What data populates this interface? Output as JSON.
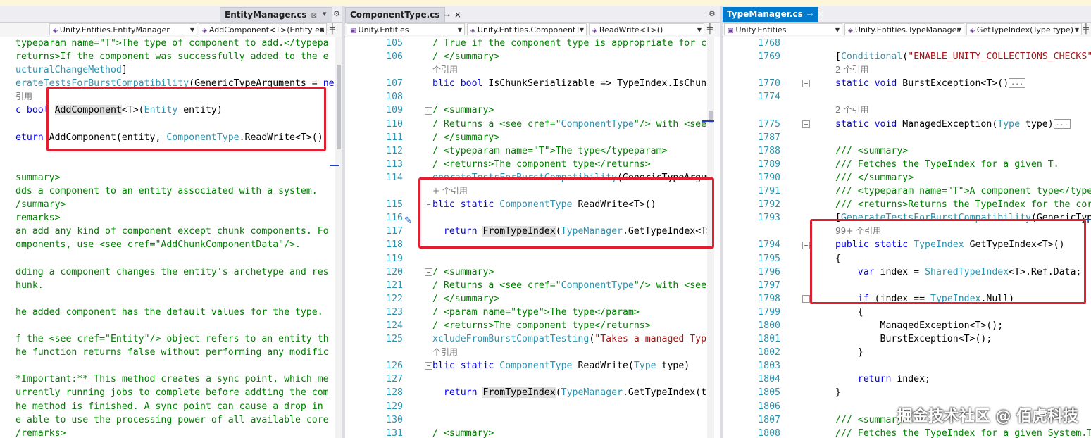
{
  "panes": [
    {
      "tab_label": "EntityManager.cs",
      "tab_pin": "⊠",
      "tab_menu": "▾",
      "tab_settings": "⚙",
      "nav": [
        "Unity.Entities.EntityManager",
        "AddComponent<T>(Entity en"
      ],
      "lines": [
        {
          "n": "",
          "segs": [
            [
              "cm",
              "typeparam name=\"T\">The type of component to add.</typepa"
            ]
          ]
        },
        {
          "n": "",
          "segs": [
            [
              "cm",
              "returns>If the component was successfully added to the e"
            ]
          ]
        },
        {
          "n": "",
          "segs": [
            [
              "ty",
              "ucturalChangeMethod"
            ],
            [
              "pl",
              "]"
            ]
          ]
        },
        {
          "n": "",
          "segs": [
            [
              "ty",
              "erateTestsForBurstCompatibility"
            ],
            [
              "pl",
              "(GenericTypeArguments = "
            ],
            [
              "kw",
              "ne"
            ]
          ]
        },
        {
          "n": "",
          "segs": [
            [
              "sm",
              "引用"
            ]
          ]
        },
        {
          "n": "",
          "segs": [
            [
              "kw",
              "c bool "
            ],
            [
              "hl",
              "AddComponent"
            ],
            [
              "pl",
              "<T>("
            ],
            [
              "ty",
              "Entity"
            ],
            [
              "pl",
              " entity)"
            ]
          ]
        },
        {
          "n": "",
          "segs": [
            [
              "pl",
              ""
            ]
          ]
        },
        {
          "n": "",
          "segs": [
            [
              "kw",
              "eturn "
            ],
            [
              "pl",
              "AddComponent(entity, "
            ],
            [
              "ty",
              "ComponentType"
            ],
            [
              "pl",
              ".ReadWrite<T>()"
            ]
          ]
        },
        {
          "n": "",
          "segs": [
            [
              "pl",
              ""
            ]
          ]
        },
        {
          "n": "",
          "segs": [
            [
              "pl",
              ""
            ]
          ]
        },
        {
          "n": "",
          "segs": [
            [
              "cm",
              "summary>"
            ]
          ]
        },
        {
          "n": "",
          "segs": [
            [
              "cm",
              "dds a component to an entity associated with a system."
            ]
          ]
        },
        {
          "n": "",
          "segs": [
            [
              "cm",
              "/summary>"
            ]
          ]
        },
        {
          "n": "",
          "segs": [
            [
              "cm",
              "remarks>"
            ]
          ]
        },
        {
          "n": "",
          "segs": [
            [
              "cm",
              "an add any kind of component except chunk components. Fo"
            ]
          ]
        },
        {
          "n": "",
          "segs": [
            [
              "cm",
              "omponents, use <see cref=\"AddChunkComponentData\"/>."
            ]
          ]
        },
        {
          "n": "",
          "segs": [
            [
              "pl",
              ""
            ]
          ]
        },
        {
          "n": "",
          "segs": [
            [
              "cm",
              "dding a component changes the entity's archetype and res"
            ]
          ]
        },
        {
          "n": "",
          "segs": [
            [
              "cm",
              "hunk."
            ]
          ]
        },
        {
          "n": "",
          "segs": [
            [
              "pl",
              ""
            ]
          ]
        },
        {
          "n": "",
          "segs": [
            [
              "cm",
              "he added component has the default values for the type."
            ]
          ]
        },
        {
          "n": "",
          "segs": [
            [
              "pl",
              ""
            ]
          ]
        },
        {
          "n": "",
          "segs": [
            [
              "cm",
              "f the <see cref=\"Entity\"/> object refers to an entity th"
            ]
          ]
        },
        {
          "n": "",
          "segs": [
            [
              "cm",
              "he function returns false without performing any modific"
            ]
          ]
        },
        {
          "n": "",
          "segs": [
            [
              "pl",
              ""
            ]
          ]
        },
        {
          "n": "",
          "segs": [
            [
              "cm",
              "*Important:** This method creates a sync point, which me"
            ]
          ]
        },
        {
          "n": "",
          "segs": [
            [
              "cm",
              "urrently running jobs to complete before addting the com"
            ]
          ]
        },
        {
          "n": "",
          "segs": [
            [
              "cm",
              "he method is finished. A sync point can cause a drop in"
            ]
          ]
        },
        {
          "n": "",
          "segs": [
            [
              "cm",
              "e able to use the processing power of all available core"
            ]
          ]
        },
        {
          "n": "",
          "segs": [
            [
              "cm",
              "/remarks>"
            ]
          ]
        }
      ]
    },
    {
      "tab_label": "ComponentType.cs",
      "tab_pin": "⊸",
      "tab_close": "×",
      "tab_settings": "⚙",
      "nav": [
        "Unity.Entities",
        "Unity.Entities.ComponentT",
        "ReadWrite<T>()"
      ],
      "lines": [
        {
          "n": "105",
          "segs": [
            [
              "cm",
              "/ True if the component type is appropriate for ch"
            ]
          ]
        },
        {
          "n": "106",
          "segs": [
            [
              "cm",
              "/ </summary>"
            ]
          ]
        },
        {
          "n": "",
          "segs": [
            [
              "sm",
              "个引用"
            ]
          ]
        },
        {
          "n": "107",
          "segs": [
            [
              "kw",
              "blic bool "
            ],
            [
              "pl",
              "IsChunkSerializable => TypeIndex.IsChunk"
            ]
          ]
        },
        {
          "n": "108",
          "segs": [
            [
              "pl",
              ""
            ]
          ]
        },
        {
          "n": "109",
          "segs": [
            [
              "cm",
              "/ <summary>"
            ]
          ]
        },
        {
          "n": "110",
          "segs": [
            [
              "cm",
              "/ Returns a <see cref=\""
            ],
            [
              "ty",
              "ComponentType"
            ],
            [
              "cm",
              "\"/> with <see"
            ]
          ]
        },
        {
          "n": "111",
          "segs": [
            [
              "cm",
              "/ </summary>"
            ]
          ]
        },
        {
          "n": "112",
          "segs": [
            [
              "cm",
              "/ <typeparam name=\"T\">The type</typeparam>"
            ]
          ]
        },
        {
          "n": "113",
          "segs": [
            [
              "cm",
              "/ <returns>The component type</returns>"
            ]
          ]
        },
        {
          "n": "114",
          "segs": [
            [
              "ty",
              "enerateTestsForBurstCompatibility"
            ],
            [
              "pl",
              "(GenericTypeArgum"
            ]
          ]
        },
        {
          "n": "",
          "segs": [
            [
              "sm",
              "+ 个引用"
            ]
          ]
        },
        {
          "n": "115",
          "segs": [
            [
              "kw",
              "blic static "
            ],
            [
              "ty",
              "ComponentType"
            ],
            [
              "pl",
              " ReadWrite<T>()"
            ]
          ]
        },
        {
          "n": "116",
          "segs": [
            [
              "pl",
              ""
            ]
          ]
        },
        {
          "n": "117",
          "segs": [
            [
              "pl",
              "  "
            ],
            [
              "kw",
              "return "
            ],
            [
              "hl",
              "FromTypeIndex"
            ],
            [
              "pl",
              "("
            ],
            [
              "ty",
              "TypeManager"
            ],
            [
              "pl",
              ".GetTypeIndex<T>"
            ]
          ]
        },
        {
          "n": "118",
          "segs": [
            [
              "pl",
              ""
            ]
          ]
        },
        {
          "n": "119",
          "segs": [
            [
              "pl",
              ""
            ]
          ]
        },
        {
          "n": "120",
          "segs": [
            [
              "cm",
              "/ <summary>"
            ]
          ]
        },
        {
          "n": "121",
          "segs": [
            [
              "cm",
              "/ Returns a <see cref=\""
            ],
            [
              "ty",
              "ComponentType"
            ],
            [
              "cm",
              "\"/> with <see"
            ]
          ]
        },
        {
          "n": "122",
          "segs": [
            [
              "cm",
              "/ </summary>"
            ]
          ]
        },
        {
          "n": "123",
          "segs": [
            [
              "cm",
              "/ <param name=\"type\">The type</param>"
            ]
          ]
        },
        {
          "n": "124",
          "segs": [
            [
              "cm",
              "/ <returns>The component type</returns>"
            ]
          ]
        },
        {
          "n": "125",
          "segs": [
            [
              "ty",
              "xcludeFromBurstCompatTesting"
            ],
            [
              "pl",
              "("
            ],
            [
              "st",
              "\"Takes a managed Type"
            ]
          ]
        },
        {
          "n": "",
          "segs": [
            [
              "sm",
              "个引用"
            ]
          ]
        },
        {
          "n": "126",
          "segs": [
            [
              "kw",
              "blic static "
            ],
            [
              "ty",
              "ComponentType"
            ],
            [
              "pl",
              " ReadWrite("
            ],
            [
              "ty",
              "Type"
            ],
            [
              "pl",
              " type)"
            ]
          ]
        },
        {
          "n": "127",
          "segs": [
            [
              "pl",
              ""
            ]
          ]
        },
        {
          "n": "128",
          "segs": [
            [
              "pl",
              "  "
            ],
            [
              "kw",
              "return "
            ],
            [
              "hl",
              "FromTypeIndex"
            ],
            [
              "pl",
              "("
            ],
            [
              "ty",
              "TypeManager"
            ],
            [
              "pl",
              ".GetTypeIndex(ty"
            ]
          ]
        },
        {
          "n": "129",
          "segs": [
            [
              "pl",
              ""
            ]
          ]
        },
        {
          "n": "130",
          "segs": [
            [
              "pl",
              ""
            ]
          ]
        },
        {
          "n": "131",
          "segs": [
            [
              "cm",
              "/ <summary>"
            ]
          ]
        }
      ]
    },
    {
      "tab_label": "TypeManager.cs",
      "tab_pin": "⊸",
      "tab_close": "×",
      "nav": [
        "Unity.Entities",
        "Unity.Entities.TypeManager",
        "GetTypeIndex(Type type)"
      ],
      "lines": [
        {
          "n": "1768",
          "segs": [
            [
              "pl",
              ""
            ]
          ]
        },
        {
          "n": "1769",
          "segs": [
            [
              "pl",
              "["
            ],
            [
              "ty",
              "Conditional"
            ],
            [
              "pl",
              "("
            ],
            [
              "st",
              "\"ENABLE_UNITY_COLLECTIONS_CHECKS\""
            ]
          ]
        },
        {
          "n": "",
          "segs": [
            [
              "sm",
              "2 个引用"
            ]
          ]
        },
        {
          "n": "1770",
          "segs": [
            [
              "kw",
              "static void "
            ],
            [
              "pl",
              "BurstException<T>()"
            ],
            [
              "box",
              "..."
            ]
          ]
        },
        {
          "n": "1774",
          "segs": [
            [
              "pl",
              ""
            ]
          ]
        },
        {
          "n": "",
          "segs": [
            [
              "sm",
              "2 个引用"
            ]
          ]
        },
        {
          "n": "1775",
          "segs": [
            [
              "kw",
              "static void "
            ],
            [
              "pl",
              "ManagedException("
            ],
            [
              "ty",
              "Type"
            ],
            [
              "pl",
              " type)"
            ],
            [
              "box",
              "..."
            ]
          ]
        },
        {
          "n": "1787",
          "segs": [
            [
              "pl",
              ""
            ]
          ]
        },
        {
          "n": "1788",
          "segs": [
            [
              "cm",
              "/// <summary>"
            ]
          ]
        },
        {
          "n": "1789",
          "segs": [
            [
              "cm",
              "/// Fetches the TypeIndex for a given T."
            ]
          ]
        },
        {
          "n": "1790",
          "segs": [
            [
              "cm",
              "/// </summary>"
            ]
          ]
        },
        {
          "n": "1791",
          "segs": [
            [
              "cm",
              "/// <typeparam name=\"T\">A component type</type"
            ]
          ]
        },
        {
          "n": "1792",
          "segs": [
            [
              "cm",
              "/// <returns>Returns the TypeIndex for the cor"
            ]
          ]
        },
        {
          "n": "1793",
          "segs": [
            [
              "pl",
              "["
            ],
            [
              "ty",
              "GenerateTestsForBurstCompatibility"
            ],
            [
              "pl",
              "(GenericTyp"
            ]
          ]
        },
        {
          "n": "",
          "segs": [
            [
              "sm",
              "99+ 个引用"
            ]
          ]
        },
        {
          "n": "1794",
          "segs": [
            [
              "kw",
              "public static "
            ],
            [
              "ty",
              "TypeIndex"
            ],
            [
              "pl",
              " GetTypeIndex<T>()"
            ]
          ]
        },
        {
          "n": "1795",
          "segs": [
            [
              "pl",
              "{"
            ]
          ]
        },
        {
          "n": "1796",
          "segs": [
            [
              "pl",
              "    "
            ],
            [
              "kw",
              "var "
            ],
            [
              "pl",
              "index = "
            ],
            [
              "ty",
              "SharedTypeIndex"
            ],
            [
              "pl",
              "<T>.Ref.Data;"
            ]
          ]
        },
        {
          "n": "1797",
          "segs": [
            [
              "pl",
              ""
            ]
          ]
        },
        {
          "n": "1798",
          "segs": [
            [
              "pl",
              "    "
            ],
            [
              "kw",
              "if "
            ],
            [
              "pl",
              "(index == "
            ],
            [
              "ty",
              "TypeIndex"
            ],
            [
              "pl",
              ".Null)"
            ]
          ]
        },
        {
          "n": "1799",
          "segs": [
            [
              "pl",
              "    {"
            ]
          ]
        },
        {
          "n": "1800",
          "segs": [
            [
              "pl",
              "        ManagedException<T>();"
            ]
          ]
        },
        {
          "n": "1801",
          "segs": [
            [
              "pl",
              "        BurstException<T>();"
            ]
          ]
        },
        {
          "n": "1802",
          "segs": [
            [
              "pl",
              "    }"
            ]
          ]
        },
        {
          "n": "1803",
          "segs": [
            [
              "pl",
              ""
            ]
          ]
        },
        {
          "n": "1804",
          "segs": [
            [
              "pl",
              "    "
            ],
            [
              "kw",
              "return "
            ],
            [
              "pl",
              "index;"
            ]
          ]
        },
        {
          "n": "1805",
          "segs": [
            [
              "pl",
              "}"
            ]
          ]
        },
        {
          "n": "1806",
          "segs": [
            [
              "pl",
              ""
            ]
          ]
        },
        {
          "n": "1807",
          "segs": [
            [
              "cm",
              "/// <summary>"
            ]
          ]
        },
        {
          "n": "1808",
          "segs": [
            [
              "cm",
              "/// Fetches the TypeIndex for a given System.T"
            ]
          ]
        }
      ]
    }
  ],
  "watermark": "掘金技术社区 @ 佰虎科技",
  "colors": {
    "active_tab": "#007acc",
    "highlight_box": "#e02030",
    "comment": "#008000",
    "keyword": "#0000ff",
    "type": "#2b91af"
  }
}
